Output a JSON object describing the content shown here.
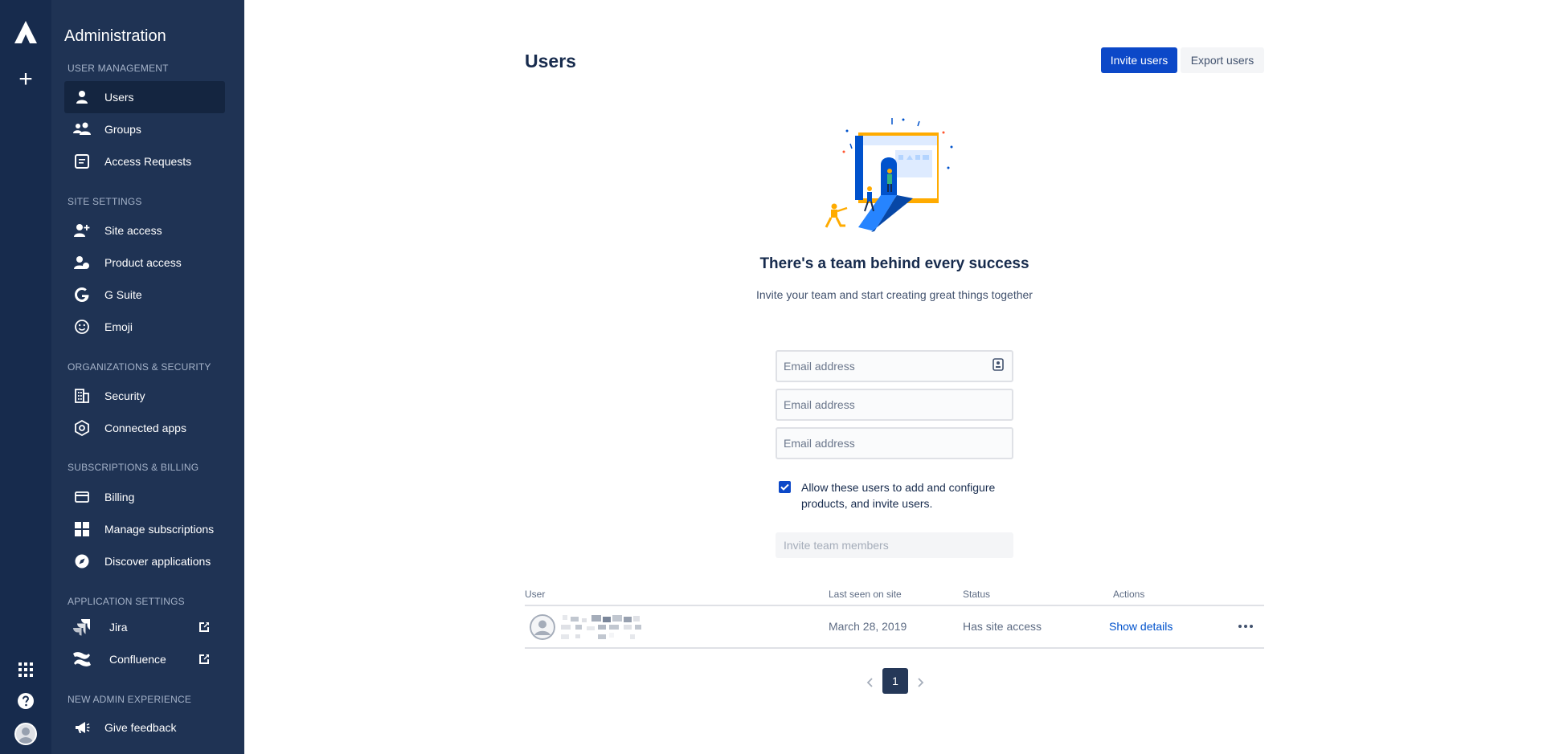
{
  "sidebar": {
    "title": "Administration",
    "sections": [
      {
        "label": "USER MANAGEMENT"
      },
      {
        "label": "SITE SETTINGS"
      },
      {
        "label": "ORGANIZATIONS & SECURITY"
      },
      {
        "label": "SUBSCRIPTIONS & BILLING"
      },
      {
        "label": "APPLICATION SETTINGS"
      },
      {
        "label": "NEW ADMIN EXPERIENCE"
      }
    ],
    "items": {
      "users": "Users",
      "groups": "Groups",
      "access_requests": "Access Requests",
      "site_access": "Site access",
      "product_access": "Product access",
      "gsuite": "G Suite",
      "emoji": "Emoji",
      "security": "Security",
      "connected_apps": "Connected apps",
      "billing": "Billing",
      "manage_subscriptions": "Manage subscriptions",
      "discover_applications": "Discover applications",
      "jira": "Jira",
      "confluence": "Confluence",
      "give_feedback": "Give feedback"
    },
    "active_item": "users"
  },
  "header": {
    "title": "Users",
    "invite_label": "Invite users",
    "export_label": "Export users"
  },
  "hero": {
    "title": "There's a team behind every success",
    "subtitle": "Invite your team and start creating great things together"
  },
  "invite_form": {
    "email_placeholder": "Email address",
    "checkbox_label": "Allow these users to add and configure products, and invite users.",
    "checkbox_checked": true,
    "submit_label": "Invite team members"
  },
  "table": {
    "columns": [
      "User",
      "Last seen on site",
      "Status",
      "Actions"
    ],
    "rows": [
      {
        "last_seen": "March 28, 2019",
        "status": "Has site access",
        "action": "Show details"
      }
    ]
  },
  "pagination": {
    "current": "1"
  },
  "colors": {
    "primary": "#0c48c8",
    "sidebar": "#1f3354",
    "rail": "#172b4d"
  }
}
